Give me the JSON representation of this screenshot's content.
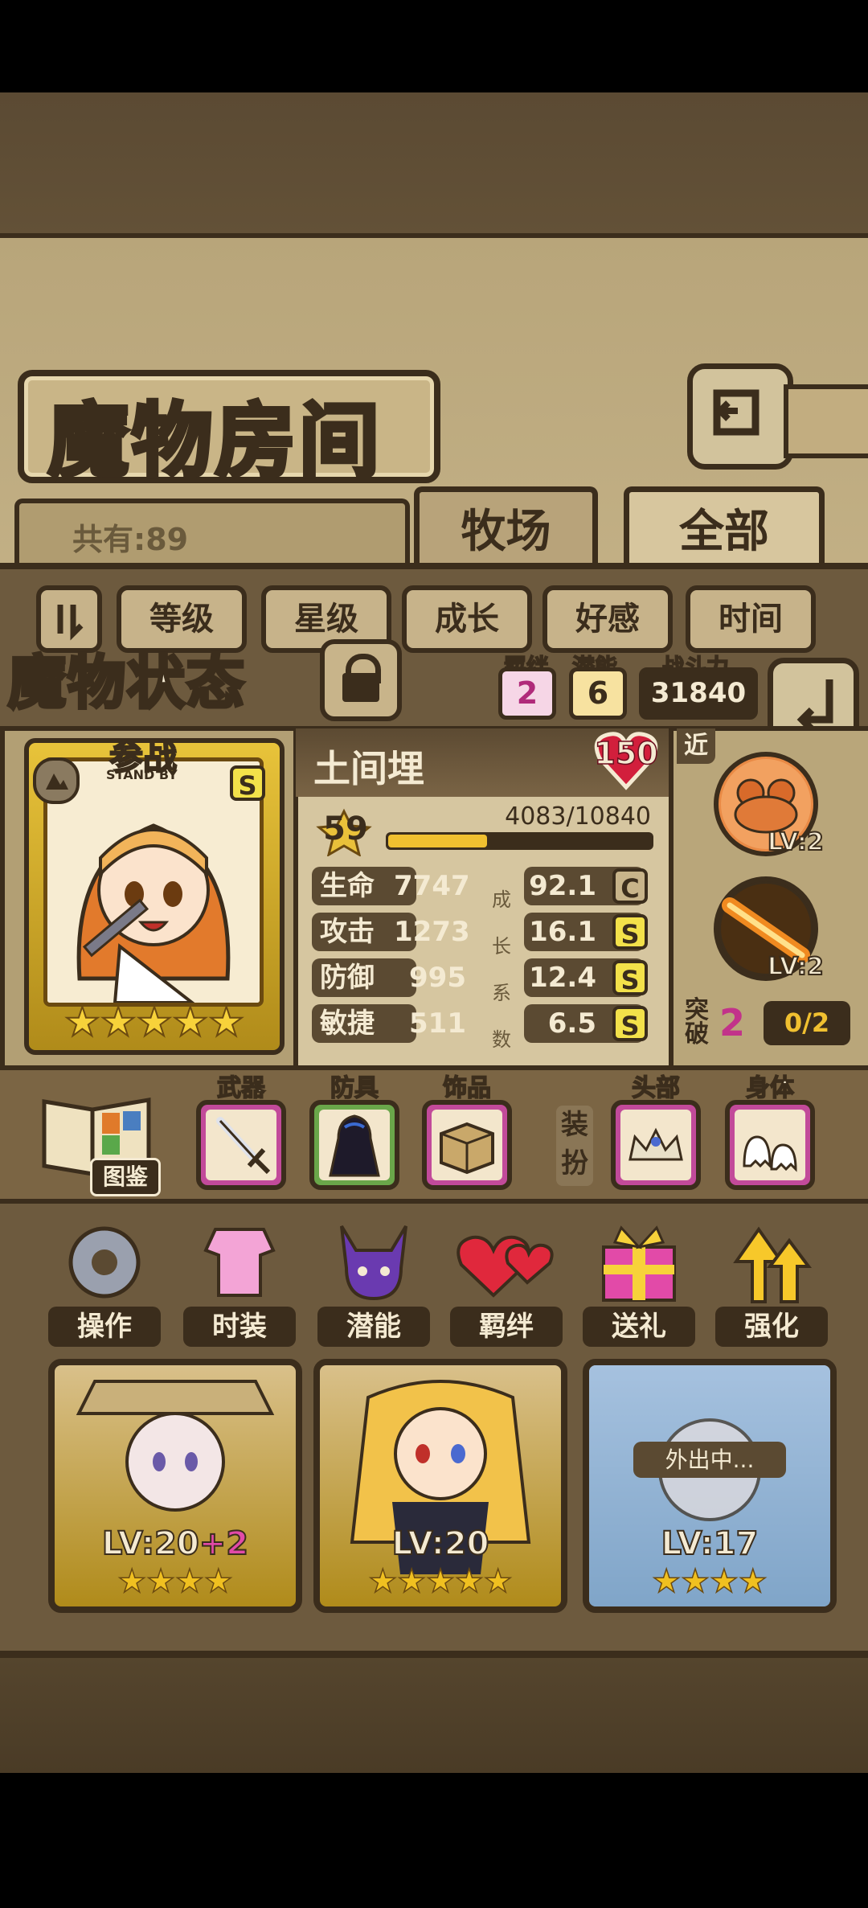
{
  "header": {
    "title": "魔物房间",
    "total": "共有:89",
    "tabs": [
      "牧场",
      "全部"
    ]
  },
  "sort_buttons": [
    "等级",
    "星级",
    "成长",
    "好感",
    "时间"
  ],
  "status": {
    "label": "魔物状态",
    "bond_label": "羁绊",
    "bond_value": "2",
    "potential_label": "潜能",
    "potential_value": "6",
    "power_label": "战斗力",
    "power_value": "31840"
  },
  "monster": {
    "badge_main": "参战",
    "badge_sub": "STAND BY",
    "grade": "S",
    "stars": "★★★★★",
    "name": "土间埋",
    "heart_value": "150",
    "level": "59",
    "exp": "4083/10840",
    "exp_progress": 0.377,
    "stats": [
      {
        "label": "生命",
        "value": "7747",
        "growth": "92.1",
        "grade": "C"
      },
      {
        "label": "攻击",
        "value": "1273",
        "growth": "16.1",
        "grade": "S"
      },
      {
        "label": "防御",
        "value": "995",
        "growth": "12.4",
        "grade": "S"
      },
      {
        "label": "敏捷",
        "value": "511",
        "growth": "6.5",
        "grade": "S"
      }
    ],
    "growth_vertical": [
      "成",
      "长",
      "系",
      "数"
    ]
  },
  "skills": {
    "range": "近",
    "skill1_level": "LV:2",
    "skill2_level": "LV:2",
    "breakthrough_label1": "突",
    "breakthrough_label2": "破",
    "breakthrough_value": "2",
    "breakthrough_progress": "0/2"
  },
  "equipment": {
    "book_label": "图鉴",
    "weapon": "武器",
    "armor": "防具",
    "accessory": "饰品",
    "dress_label1": "装",
    "dress_label2": "扮",
    "head": "头部",
    "body": "身体"
  },
  "actions": [
    "操作",
    "时装",
    "潜能",
    "羁绊",
    "送礼",
    "强化"
  ],
  "roster": [
    {
      "level": "LV:20",
      "bonus": "+2",
      "stars": "★★★★"
    },
    {
      "level": "LV:20",
      "bonus": "",
      "stars": "★★★★★"
    },
    {
      "level": "LV:17",
      "bonus": "",
      "stars": "★★★★",
      "status": "外出中..."
    }
  ],
  "colors": {
    "outline": "#3b2d1c",
    "parchment": "#c9b78c",
    "pink_box": "#c24a9a",
    "gold": "#e8c33a",
    "grade_s": "#e8c33a",
    "grade_c": "#c8b48a"
  }
}
